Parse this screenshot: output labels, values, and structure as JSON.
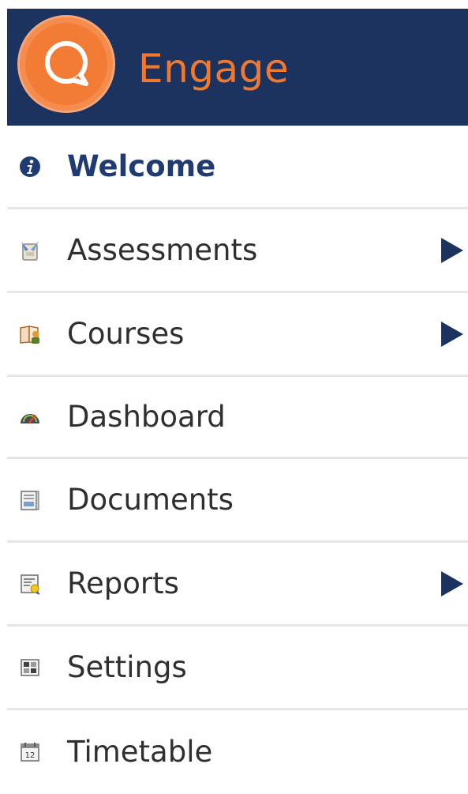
{
  "app": {
    "brand": "Engage"
  },
  "colors": {
    "header_bg": "#1c335f",
    "brand_orange": "#f0782f",
    "active_text": "#1f3b72",
    "divider": "#e6e6e6"
  },
  "nav": {
    "items": [
      {
        "label": "Welcome",
        "icon": "info-icon",
        "active": true,
        "has_submenu": false
      },
      {
        "label": "Assessments",
        "icon": "assessment-icon",
        "active": false,
        "has_submenu": true
      },
      {
        "label": "Courses",
        "icon": "book-icon",
        "active": false,
        "has_submenu": true
      },
      {
        "label": "Dashboard",
        "icon": "gauge-icon",
        "active": false,
        "has_submenu": false
      },
      {
        "label": "Documents",
        "icon": "document-icon",
        "active": false,
        "has_submenu": false
      },
      {
        "label": "Reports",
        "icon": "report-icon",
        "active": false,
        "has_submenu": true
      },
      {
        "label": "Settings",
        "icon": "settings-icon",
        "active": false,
        "has_submenu": false
      },
      {
        "label": "Timetable",
        "icon": "calendar-icon",
        "active": false,
        "has_submenu": false
      }
    ]
  },
  "timetable_icon_text": "12"
}
